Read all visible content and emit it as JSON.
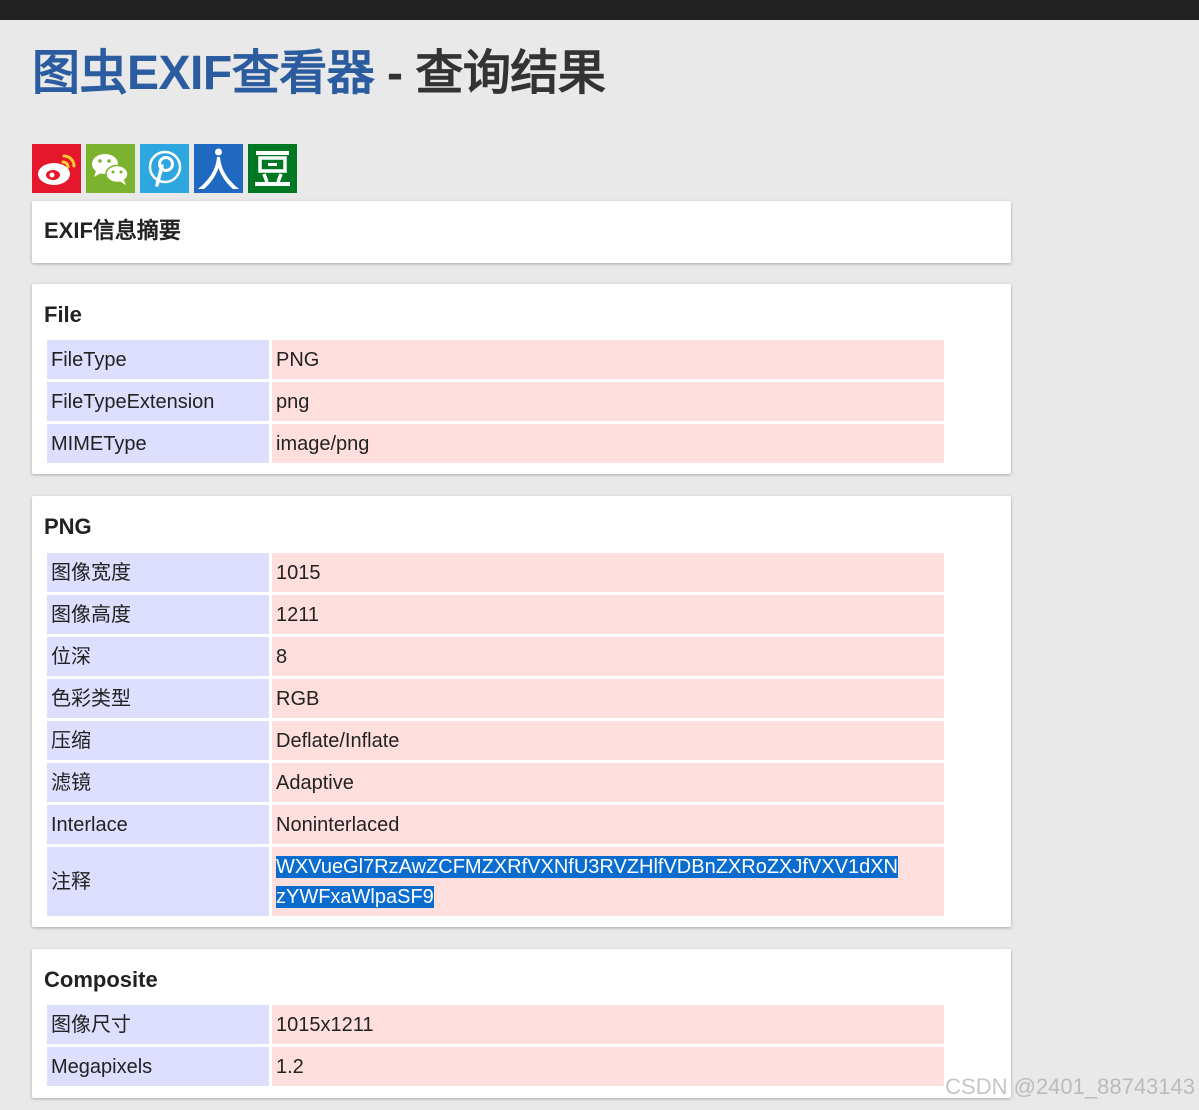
{
  "title": {
    "brand": "图虫EXIF查看器",
    "rest": " - 查询结果"
  },
  "share_icons": [
    "weibo-icon",
    "wechat-icon",
    "pinterest-icon",
    "renren-icon",
    "douban-icon"
  ],
  "colors": {
    "brand_blue": "#2a5c9f",
    "key_cell": "#dedeff",
    "value_cell": "#ffdede",
    "weibo": "#e6162d",
    "wechat": "#7bb32e",
    "pinterest": "#2ea7e0",
    "renren": "#1f69c1",
    "douban": "#007722",
    "selection": "#0a6ccf"
  },
  "summary": {
    "title": "EXIF信息摘要"
  },
  "file": {
    "title": "File",
    "rows": [
      {
        "key": "FileType",
        "value": "PNG"
      },
      {
        "key": "FileTypeExtension",
        "value": "png"
      },
      {
        "key": "MIMEType",
        "value": "image/png"
      }
    ]
  },
  "png": {
    "title": "PNG",
    "rows": [
      {
        "key": "图像宽度",
        "value": "1015"
      },
      {
        "key": "图像高度",
        "value": "1211"
      },
      {
        "key": "位深",
        "value": "8"
      },
      {
        "key": "色彩类型",
        "value": "RGB"
      },
      {
        "key": "压缩",
        "value": "Deflate/Inflate"
      },
      {
        "key": "滤镜",
        "value": "Adaptive"
      },
      {
        "key": "Interlace",
        "value": "Noninterlaced"
      },
      {
        "key": "注释",
        "value_line1": "WXVueGl7RzAwZCFMZXRfVXNfU3RVZHlfVDBnZXRoZXJfVXV1dXN",
        "value_line2": "zYWFxaWlpaSF9"
      }
    ]
  },
  "composite": {
    "title": "Composite",
    "rows": [
      {
        "key": "图像尺寸",
        "value": "1015x1211"
      },
      {
        "key": "Megapixels",
        "value": "1.2"
      }
    ]
  },
  "watermark": "CSDN @2401_88743143"
}
